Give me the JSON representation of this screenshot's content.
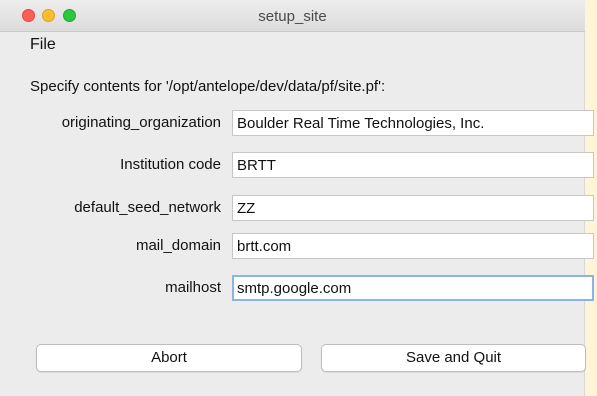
{
  "window": {
    "title": "setup_site",
    "controls": {
      "close_color": "#fd5f57",
      "minimize_color": "#febc2e",
      "maximize_color": "#2ac840"
    }
  },
  "menubar": {
    "items": [
      {
        "label": "File"
      }
    ]
  },
  "form": {
    "heading": "Specify contents for '/opt/antelope/dev/data/pf/site.pf':",
    "fields": [
      {
        "label": "originating_organization",
        "value": "Boulder Real Time Technologies, Inc."
      },
      {
        "label": "Institution code",
        "value": "BRTT"
      },
      {
        "label": "default_seed_network",
        "value": "ZZ"
      },
      {
        "label": "mail_domain",
        "value": "brtt.com"
      },
      {
        "label": "mailhost",
        "value": "smtp.google.com",
        "focused": true
      }
    ]
  },
  "buttons": {
    "abort_label": "Abort",
    "save_label": "Save and Quit"
  }
}
